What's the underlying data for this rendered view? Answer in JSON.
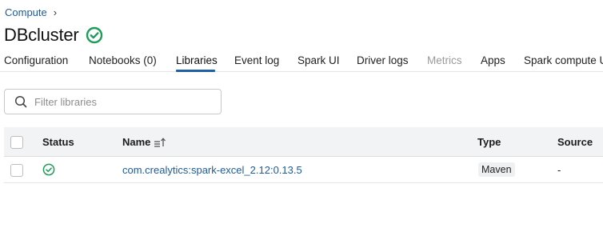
{
  "breadcrumb": {
    "parent": "Compute",
    "separator": "›"
  },
  "page": {
    "title": "DBcluster",
    "status_icon": "check-circle-icon",
    "status_color": "#1f9b5a"
  },
  "tabs": [
    {
      "label": "Configuration",
      "state": "normal"
    },
    {
      "label": "Notebooks (0)",
      "state": "normal"
    },
    {
      "label": "Libraries",
      "state": "active"
    },
    {
      "label": "Event log",
      "state": "normal"
    },
    {
      "label": "Spark UI",
      "state": "normal"
    },
    {
      "label": "Driver logs",
      "state": "normal"
    },
    {
      "label": "Metrics",
      "state": "disabled"
    },
    {
      "label": "Apps",
      "state": "normal"
    },
    {
      "label": "Spark compute U",
      "state": "normal"
    }
  ],
  "filter": {
    "placeholder": "Filter libraries",
    "value": "",
    "icon": "search-icon"
  },
  "table": {
    "columns": {
      "status": "Status",
      "name": "Name",
      "type": "Type",
      "source": "Source"
    },
    "sort_icon": "sort-ascending-icon",
    "rows": [
      {
        "status_icon": "check-circle-icon",
        "name": "com.crealytics:spark-excel_2.12:0.13.5",
        "type": "Maven",
        "source": "-"
      }
    ]
  },
  "colors": {
    "link": "#1d5b9a",
    "accent": "#1e5fa8",
    "success": "#1f9b5a"
  }
}
